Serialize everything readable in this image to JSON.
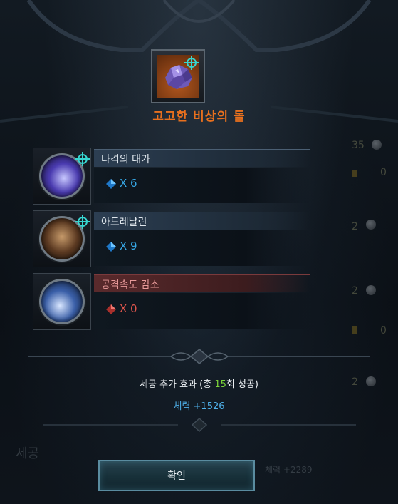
{
  "item": {
    "name": "고고한 비상의 돌",
    "icon": "purple-crystal-icon",
    "badge": "cyan-star-icon"
  },
  "effects": [
    {
      "title": "타격의 대가",
      "count": "X 6",
      "gem": "blue-diamond-icon",
      "type": "positive",
      "color": "#37a9e8"
    },
    {
      "title": "아드레날린",
      "count": "X 9",
      "gem": "blue-diamond-icon",
      "type": "positive",
      "color": "#37a9e8"
    },
    {
      "title": "공격속도 감소",
      "count": "X 0",
      "gem": "red-diamond-icon",
      "type": "negative",
      "color": "#e0564d"
    }
  ],
  "bonus": {
    "prefix": "세공 추가 효과 (총 ",
    "success_count": "15",
    "suffix": "회 성공)",
    "stat": "체력 +1526"
  },
  "confirm_label": "확인",
  "background": {
    "left_text": "세공",
    "right_stat": "체력 +2289",
    "right_numbers": [
      "35",
      "0",
      "2",
      "2",
      "0",
      "2"
    ]
  }
}
